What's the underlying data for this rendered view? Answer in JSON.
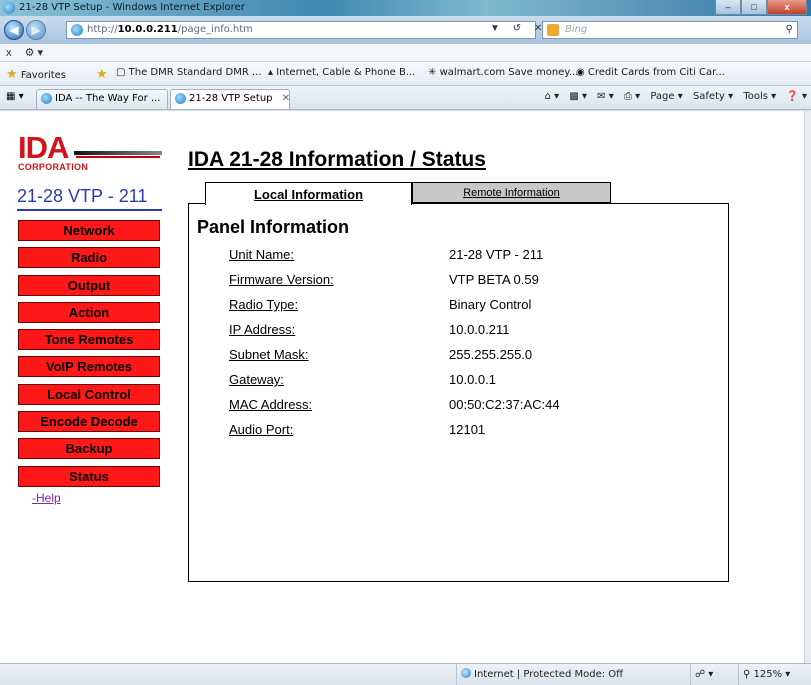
{
  "browser": {
    "window_title": "21-28 VTP Setup - Windows Internet Explorer",
    "url_prefix": "http://",
    "url_host": "10.0.0.211",
    "url_path": "/page_info.htm",
    "search_placeholder": "Bing",
    "toolbar_close": "x",
    "favorites_label": "Favorites",
    "favorites": [
      "The DMR Standard  DMR ...",
      "Internet, Cable & Phone B...",
      "walmart.com Save money...",
      "Credit Cards from Citi Car..."
    ],
    "tabs": [
      {
        "label": "IDA -- The Way For ..."
      },
      {
        "label": "21-28 VTP Setup"
      }
    ],
    "commands": [
      "Page ▾",
      "Safety ▾",
      "Tools ▾"
    ],
    "status_zone": "Internet | Protected Mode: Off",
    "zoom": "125%"
  },
  "logo": {
    "text": "IDA",
    "subtext": "CORPORATION"
  },
  "unit_label": "21-28 VTP - 211",
  "nav": {
    "items": [
      "Network",
      "Radio",
      "Output",
      "Action",
      "Tone Remotes",
      "VoIP Remotes",
      "Local Control",
      "Encode Decode",
      "Backup",
      "Status"
    ],
    "help_prefix": "-",
    "help": "Help"
  },
  "page": {
    "heading": "IDA 21-28 Information / Status",
    "tab_local": "Local Information",
    "tab_remote": "Remote Information",
    "section_title": "Panel Information",
    "rows": [
      {
        "label": "Unit Name:",
        "value": "21-28 VTP - 211"
      },
      {
        "label": "Firmware Version:",
        "value": "VTP BETA 0.59"
      },
      {
        "label": "Radio Type:",
        "value": "Binary Control"
      },
      {
        "label": "IP Address:",
        "value": "10.0.0.211"
      },
      {
        "label": "Subnet Mask:",
        "value": "255.255.255.0"
      },
      {
        "label": "Gateway:",
        "value": "10.0.0.1"
      },
      {
        "label": "MAC Address:",
        "value": "00:50:C2:37:AC:44"
      },
      {
        "label": "Audio Port:",
        "value": "12101"
      }
    ]
  },
  "colors": {
    "nav_button": "#ff1818",
    "brand_red": "#d3121a",
    "unit_label": "#2a3bb5",
    "remote_tab_bg": "#c8c8c8"
  }
}
